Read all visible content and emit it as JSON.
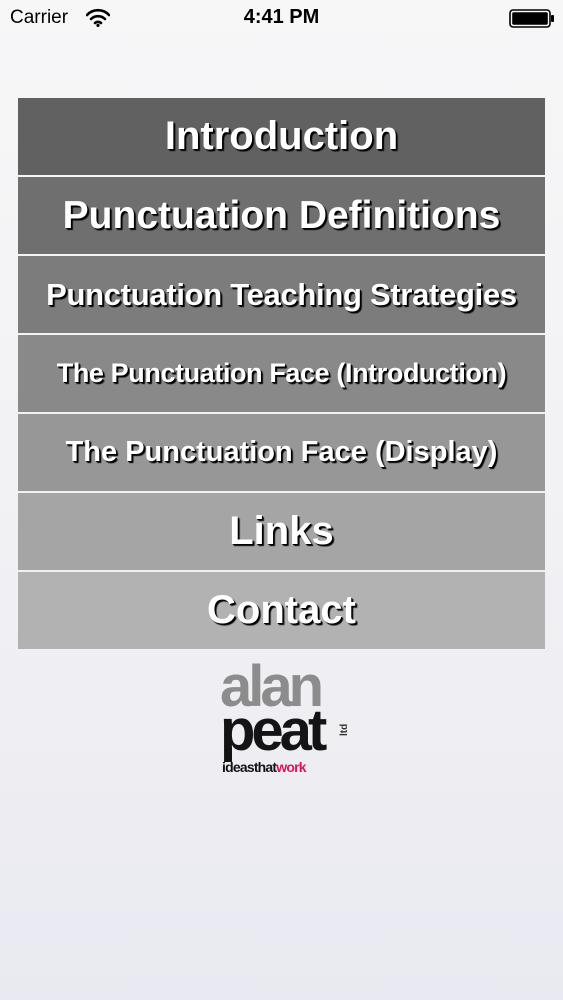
{
  "status_bar": {
    "carrier": "Carrier",
    "time": "4:41 PM",
    "wifi_icon": "wifi-icon",
    "battery_icon": "battery-full-icon"
  },
  "menu": {
    "items": [
      {
        "label": "Introduction",
        "color": "#616161"
      },
      {
        "label": "Punctuation Definitions",
        "color": "#6f6f6f"
      },
      {
        "label": "Punctuation Teaching Strategies",
        "color": "#7c7c7c"
      },
      {
        "label": "The Punctuation Face (Introduction)",
        "color": "#898989"
      },
      {
        "label": "The Punctuation Face (Display)",
        "color": "#979797"
      },
      {
        "label": "Links",
        "color": "#a5a5a5"
      },
      {
        "label": "Contact",
        "color": "#b2b2b2"
      }
    ]
  },
  "logo": {
    "line1": "alan",
    "line2": "peat",
    "tagline_part1": "ideas",
    "tagline_part2": "that",
    "tagline_part3": "work",
    "suffix": "ltd",
    "accent_color": "#d8185a"
  }
}
